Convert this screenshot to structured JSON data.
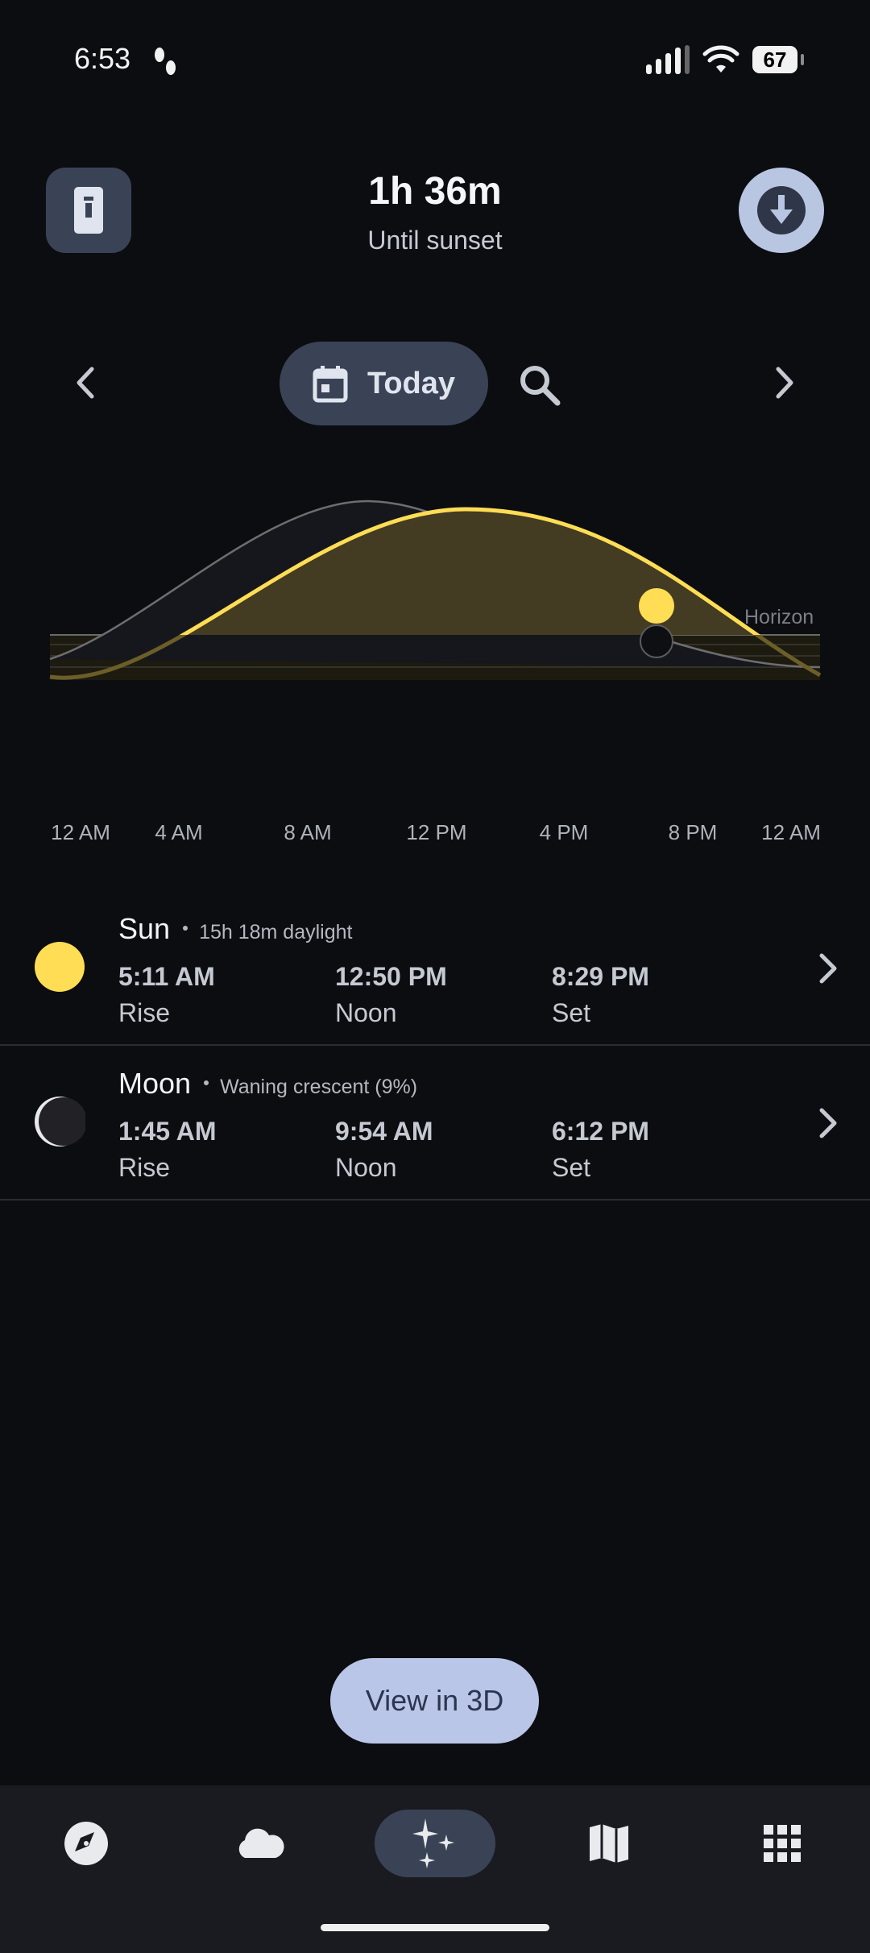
{
  "status_bar": {
    "time": "6:53",
    "battery": "67"
  },
  "header": {
    "title": "1h 36m",
    "subtitle": "Until sunset"
  },
  "date_nav": {
    "label": "Today"
  },
  "chart": {
    "horizon_label": "Horizon",
    "x_ticks": [
      "12 AM",
      "4 AM",
      "8 AM",
      "12 PM",
      "4 PM",
      "8 PM",
      "12 AM"
    ]
  },
  "sun": {
    "title": "Sun",
    "subtitle": "15h 18m daylight",
    "rise_time": "5:11 AM",
    "rise_label": "Rise",
    "noon_time": "12:50 PM",
    "noon_label": "Noon",
    "set_time": "8:29 PM",
    "set_label": "Set",
    "color": "#ffdd55"
  },
  "moon": {
    "title": "Moon",
    "subtitle": "Waning crescent (9%)",
    "rise_time": "1:45 AM",
    "rise_label": "Rise",
    "noon_time": "9:54 AM",
    "noon_label": "Noon",
    "set_time": "6:12 PM",
    "set_label": "Set"
  },
  "view3d_label": "View in 3D",
  "bottom_nav": {
    "items": [
      {
        "icon": "compass-icon",
        "active": false
      },
      {
        "icon": "cloud-icon",
        "active": false
      },
      {
        "icon": "sparkles-icon",
        "active": true
      },
      {
        "icon": "map-icon",
        "active": false
      },
      {
        "icon": "apps-grid-icon",
        "active": false
      }
    ]
  }
}
